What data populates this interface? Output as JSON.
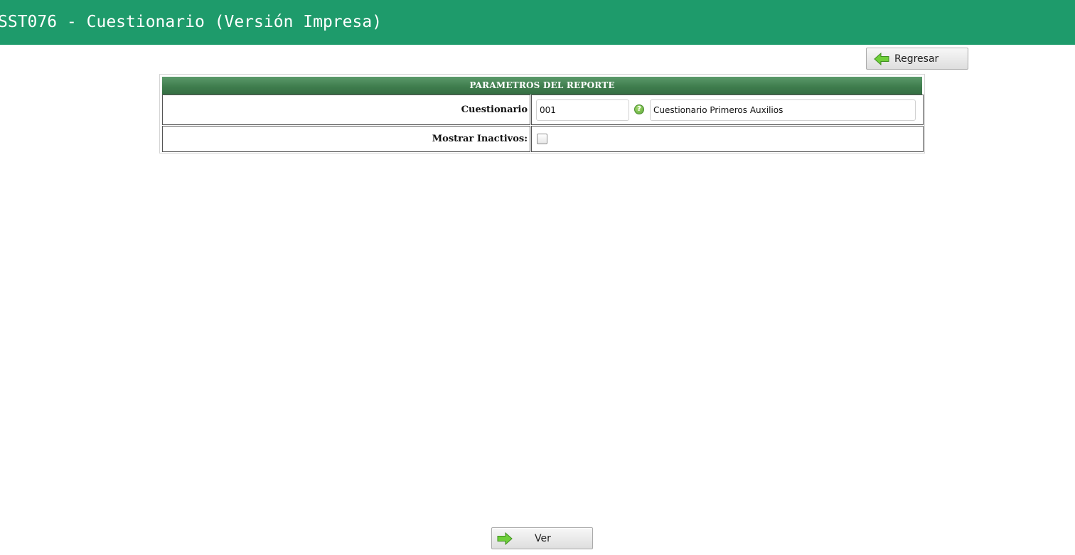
{
  "window": {
    "title": "SST076 - Cuestionario (Versión Impresa)"
  },
  "toolbar": {
    "back_label": "Regresar",
    "back_icon": "arrow-left-icon"
  },
  "params": {
    "header": "PARAMETROS DEL REPORTE",
    "cuestionario": {
      "label": "Cuestionario",
      "code_value": "001",
      "help_icon": "help-icon",
      "description_value": "Cuestionario Primeros Auxilios"
    },
    "mostrar_inactivos": {
      "label": "Mostrar Inactivos:",
      "checked": false
    }
  },
  "footer": {
    "view_label": "Ver",
    "view_icon": "arrow-right-icon"
  },
  "colors": {
    "titlebar": "#1e9b6b",
    "header_green": "#3f7d4e",
    "arrow_green": "#6fcf3a"
  }
}
